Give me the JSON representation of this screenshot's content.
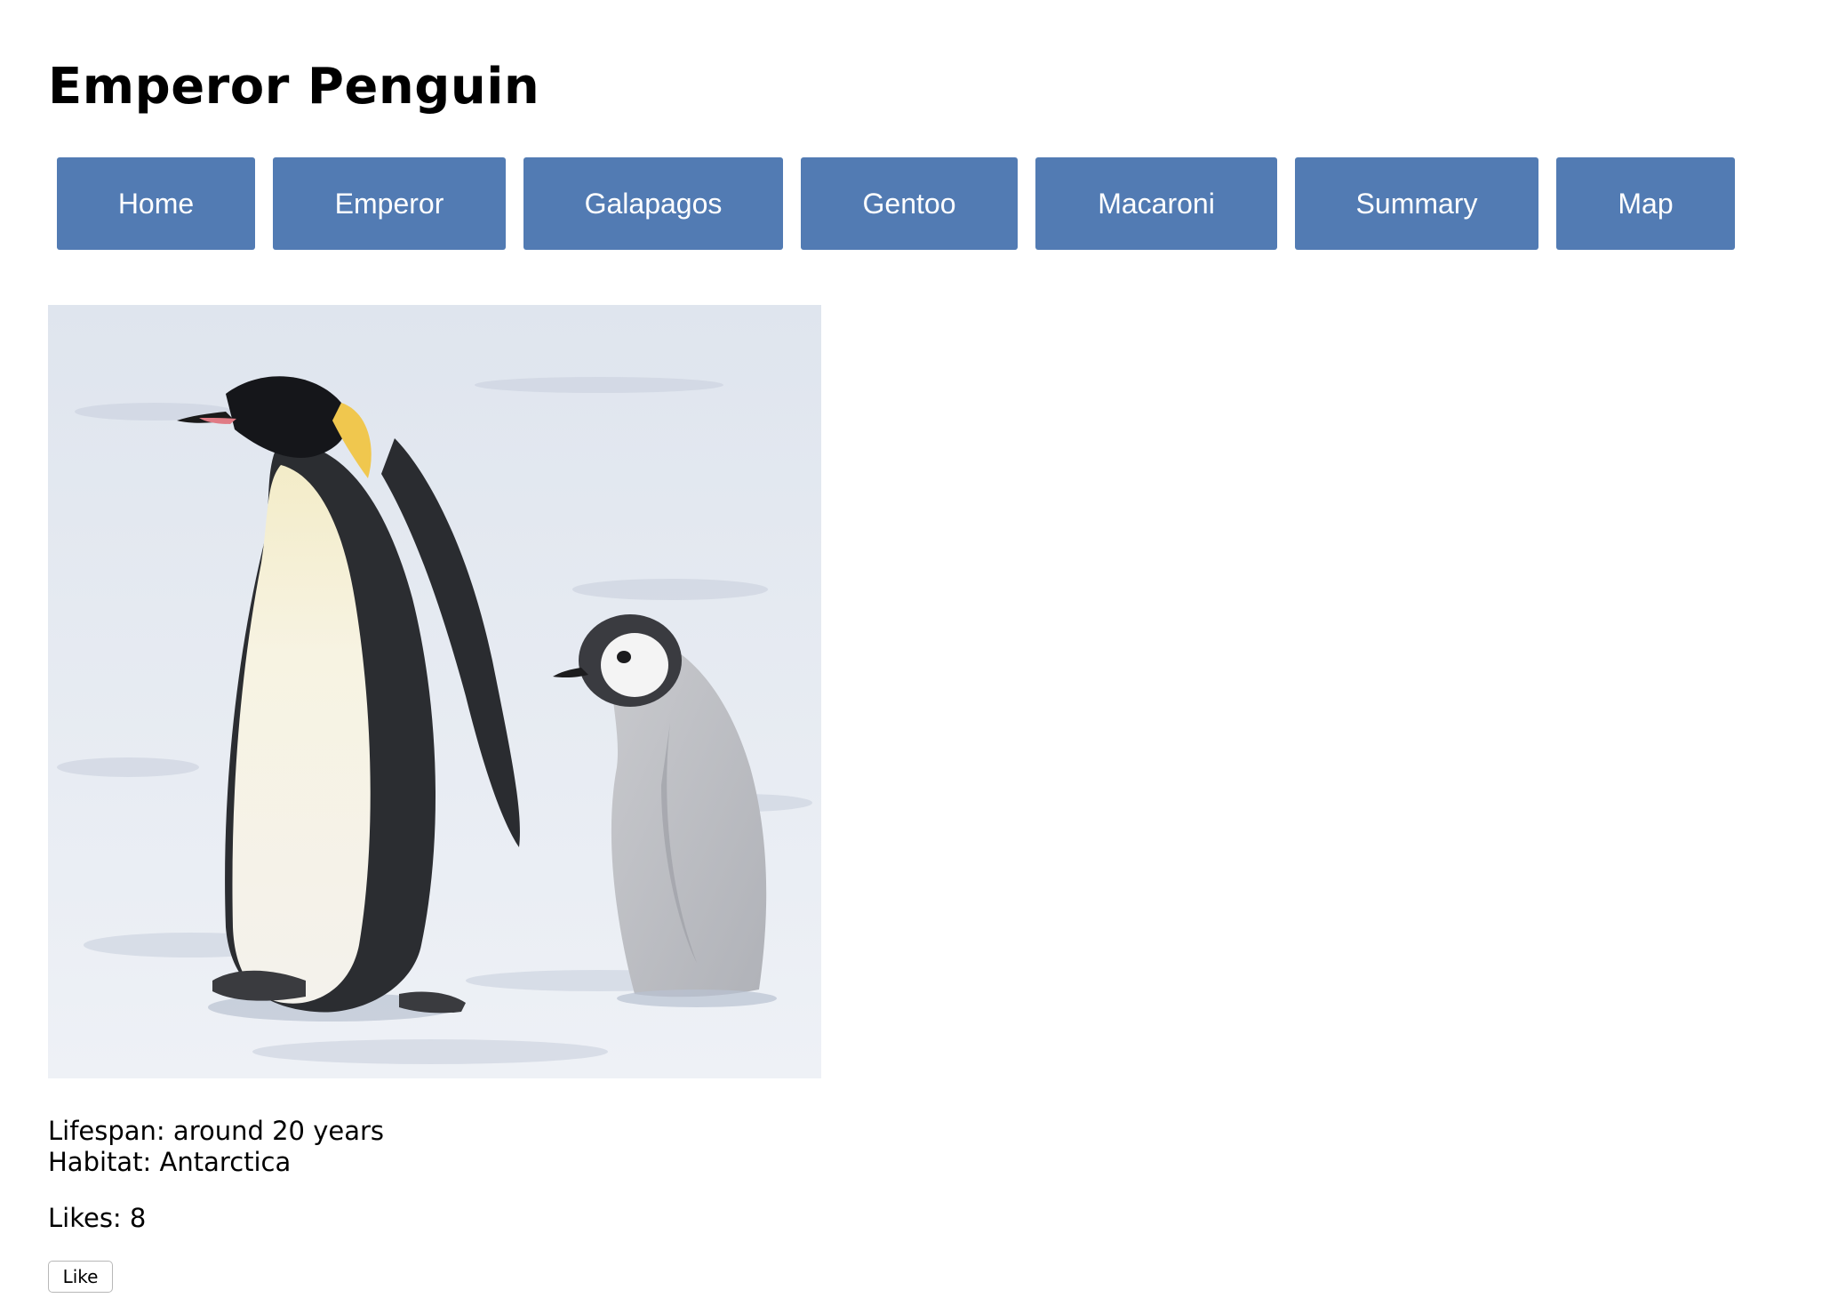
{
  "page": {
    "title": "Emperor Penguin"
  },
  "nav": {
    "home": "Home",
    "emperor": "Emperor",
    "galapagos": "Galapagos",
    "gentoo": "Gentoo",
    "macaroni": "Macaroni",
    "summary": "Summary",
    "map": "Map"
  },
  "details": {
    "lifespan": "Lifespan: around 20 years",
    "habitat": "Habitat: Antarctica",
    "likes": "Likes: 8"
  },
  "like_button": "Like",
  "colors": {
    "nav_bg": "#527bb3",
    "nav_text": "#ffffff"
  }
}
